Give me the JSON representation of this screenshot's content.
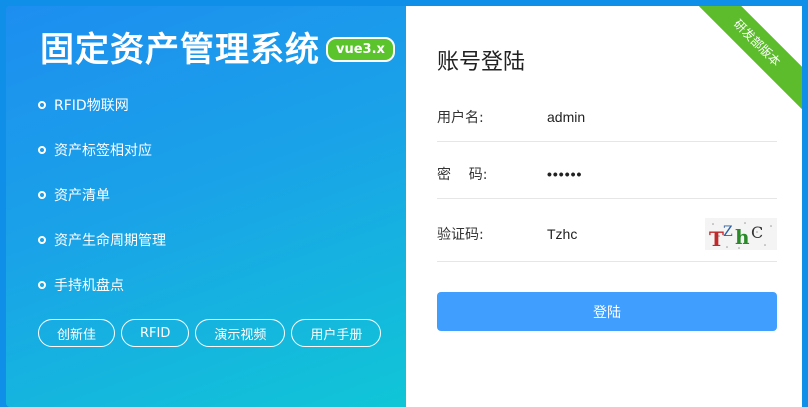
{
  "brand": {
    "title": "固定资产管理系统",
    "version": "vue3.x"
  },
  "features": [
    "RFID物联网",
    "资产标签相对应",
    "资产清单",
    "资产生命周期管理",
    "手持机盘点"
  ],
  "links": [
    "创新佳",
    "RFID",
    "演示视频",
    "用户手册"
  ],
  "ribbon": "研发部版本",
  "login": {
    "title": "账号登陆",
    "username_label": "用户名:",
    "username_value": "admin",
    "password_label": "密    码:",
    "password_value": "••••••",
    "captcha_label": "验证码:",
    "captcha_value": "Tzhc",
    "captcha_image_text": "TZhC",
    "submit_label": "登陆"
  },
  "colors": {
    "accent": "#409eff",
    "ribbon": "#5cbc2c",
    "badge": "#5bc42c"
  }
}
